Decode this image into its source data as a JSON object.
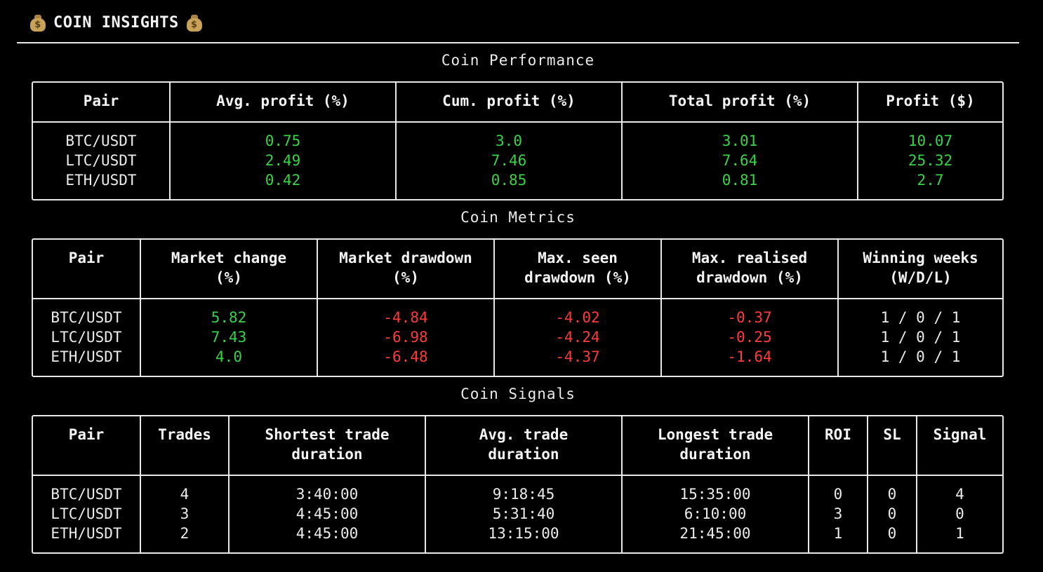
{
  "app": {
    "title": "COIN INSIGHTS"
  },
  "colors": {
    "positive": "#39d34a",
    "negative": "#ff3b3b",
    "text": "#e8e8e8"
  },
  "performance": {
    "title": "Coin Performance",
    "headers": [
      "Pair",
      "Avg. profit (%)",
      "Cum. profit (%)",
      "Total profit (%)",
      "Profit ($)"
    ],
    "rows": [
      [
        "BTC/USDT",
        "0.75",
        "3.0",
        "3.01",
        "10.07"
      ],
      [
        "LTC/USDT",
        "2.49",
        "7.46",
        "7.64",
        "25.32"
      ],
      [
        "ETH/USDT",
        "0.42",
        "0.85",
        "0.81",
        "2.7"
      ]
    ]
  },
  "metrics": {
    "title": "Coin Metrics",
    "headers": [
      "Pair",
      "Market change\n(%)",
      "Market drawdown\n(%)",
      "Max. seen\ndrawdown (%)",
      "Max. realised\ndrawdown (%)",
      "Winning weeks\n(W/D/L)"
    ],
    "rows": [
      [
        "BTC/USDT",
        "5.82",
        "-4.84",
        "-4.02",
        "-0.37",
        "1 / 0 / 1"
      ],
      [
        "LTC/USDT",
        "7.43",
        "-6.98",
        "-4.24",
        "-0.25",
        "1 / 0 / 1"
      ],
      [
        "ETH/USDT",
        "4.0",
        "-6.48",
        "-4.37",
        "-1.64",
        "1 / 0 / 1"
      ]
    ]
  },
  "signals": {
    "title": "Coin Signals",
    "headers": [
      "Pair",
      "Trades",
      "Shortest trade\nduration",
      "Avg. trade\nduration",
      "Longest trade\nduration",
      "ROI",
      "SL",
      "Signal"
    ],
    "rows": [
      [
        "BTC/USDT",
        "4",
        "3:40:00",
        "9:18:45",
        "15:35:00",
        "0",
        "0",
        "4"
      ],
      [
        "LTC/USDT",
        "3",
        "4:45:00",
        "5:31:40",
        "6:10:00",
        "3",
        "0",
        "0"
      ],
      [
        "ETH/USDT",
        "2",
        "4:45:00",
        "13:15:00",
        "21:45:00",
        "1",
        "0",
        "1"
      ]
    ]
  }
}
